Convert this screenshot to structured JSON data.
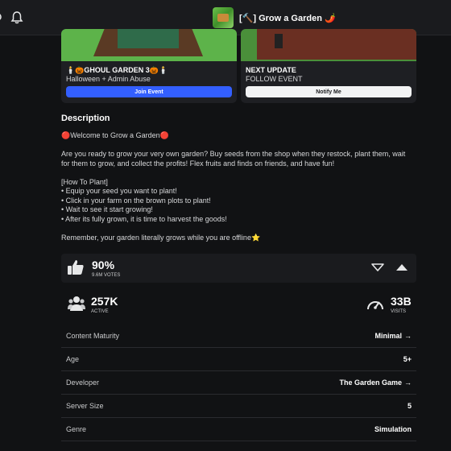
{
  "topbar": {
    "game_title": "[🔨] Grow a Garden 🌶️"
  },
  "events": [
    {
      "title": "🕯️🎃GHOUL GARDEN 3🎃🕯️",
      "subtitle": "Halloween + Admin Abuse",
      "button": "Join Event"
    },
    {
      "title": "NEXT UPDATE",
      "subtitle": "FOLLOW EVENT",
      "button": "Notify Me"
    }
  ],
  "description": {
    "heading": "Description",
    "welcome": "🔴Welcome to Grow a Garden🔴",
    "intro": "Are you ready to grow your very own garden? Buy seeds from the shop when they restock, plant them, wait for them to grow, and collect the profits! Flex fruits and finds on friends, and have fun!",
    "how_header": "[How To Plant]",
    "steps": [
      "• Equip your seed you want to plant!",
      "• Click in your farm on the brown plots to plant!",
      "• Wait to see it start growing!",
      "• After its fully grown, it is time to harvest the goods!"
    ],
    "outro": "Remember, your garden literally grows while you are offline⭐"
  },
  "votes": {
    "percent": "90%",
    "count": "9.6M VOTES"
  },
  "stats": {
    "active": "257K",
    "active_label": "ACTIVE",
    "visits": "33B",
    "visits_label": "VISITS"
  },
  "info": [
    {
      "key": "Content Maturity",
      "value": "Minimal",
      "arrow": "→"
    },
    {
      "key": "Age",
      "value": "5+",
      "arrow": ""
    },
    {
      "key": "Developer",
      "value": "The Garden Game",
      "arrow": "→"
    },
    {
      "key": "Server Size",
      "value": "5",
      "arrow": ""
    },
    {
      "key": "Genre",
      "value": "Simulation",
      "arrow": ""
    }
  ],
  "colors": {
    "background": "#111214",
    "panel": "#1e1f23",
    "join_button": "#335fff",
    "notify_button": "#f2f3f4"
  }
}
